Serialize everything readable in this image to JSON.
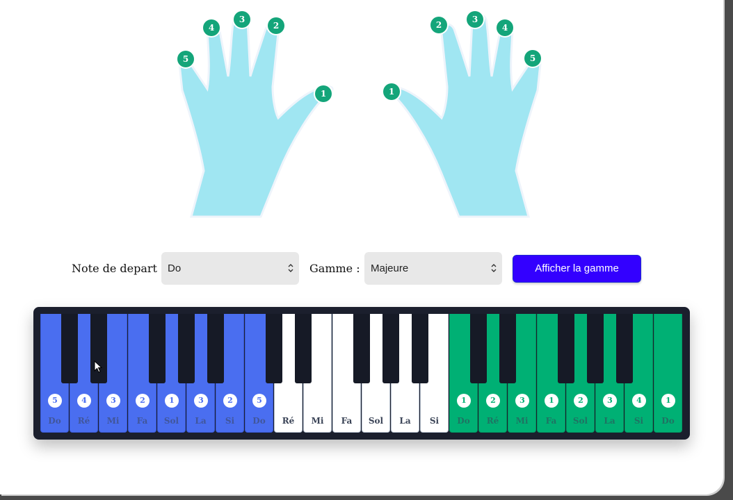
{
  "controls": {
    "start_note_label": "Note de depart :",
    "start_note_value": "Do",
    "scale_label": "Gamme :",
    "scale_value": "Majeure",
    "show_button": "Afficher la gamme"
  },
  "hands": {
    "left_fingers": [
      "5",
      "4",
      "3",
      "2",
      "1"
    ],
    "right_fingers": [
      "1",
      "2",
      "3",
      "4",
      "5"
    ]
  },
  "piano": {
    "white_keys": [
      {
        "note": "Do",
        "finger": "5",
        "hand": "left"
      },
      {
        "note": "Ré",
        "finger": "4",
        "hand": "left"
      },
      {
        "note": "Mi",
        "finger": "3",
        "hand": "left"
      },
      {
        "note": "Fa",
        "finger": "2",
        "hand": "left"
      },
      {
        "note": "Sol",
        "finger": "1",
        "hand": "left"
      },
      {
        "note": "La",
        "finger": "3",
        "hand": "left"
      },
      {
        "note": "Si",
        "finger": "2",
        "hand": "left"
      },
      {
        "note": "Do",
        "finger": "5",
        "hand": "left"
      },
      {
        "note": "Ré",
        "finger": "",
        "hand": "none"
      },
      {
        "note": "Mi",
        "finger": "",
        "hand": "none"
      },
      {
        "note": "Fa",
        "finger": "",
        "hand": "none"
      },
      {
        "note": "Sol",
        "finger": "",
        "hand": "none"
      },
      {
        "note": "La",
        "finger": "",
        "hand": "none"
      },
      {
        "note": "Si",
        "finger": "",
        "hand": "none"
      },
      {
        "note": "Do",
        "finger": "1",
        "hand": "right"
      },
      {
        "note": "Ré",
        "finger": "2",
        "hand": "right"
      },
      {
        "note": "Mi",
        "finger": "3",
        "hand": "right"
      },
      {
        "note": "Fa",
        "finger": "1",
        "hand": "right"
      },
      {
        "note": "Sol",
        "finger": "2",
        "hand": "right"
      },
      {
        "note": "La",
        "finger": "3",
        "hand": "right"
      },
      {
        "note": "Si",
        "finger": "4",
        "hand": "right"
      },
      {
        "note": "Do",
        "finger": "1",
        "hand": "right"
      }
    ]
  },
  "colors": {
    "left_hand_key": "#4a6ef0",
    "right_hand_key": "#00b074",
    "finger_badge": "#14a57a",
    "hand_fill": "#a0e6f2",
    "button": "#3300ff"
  }
}
